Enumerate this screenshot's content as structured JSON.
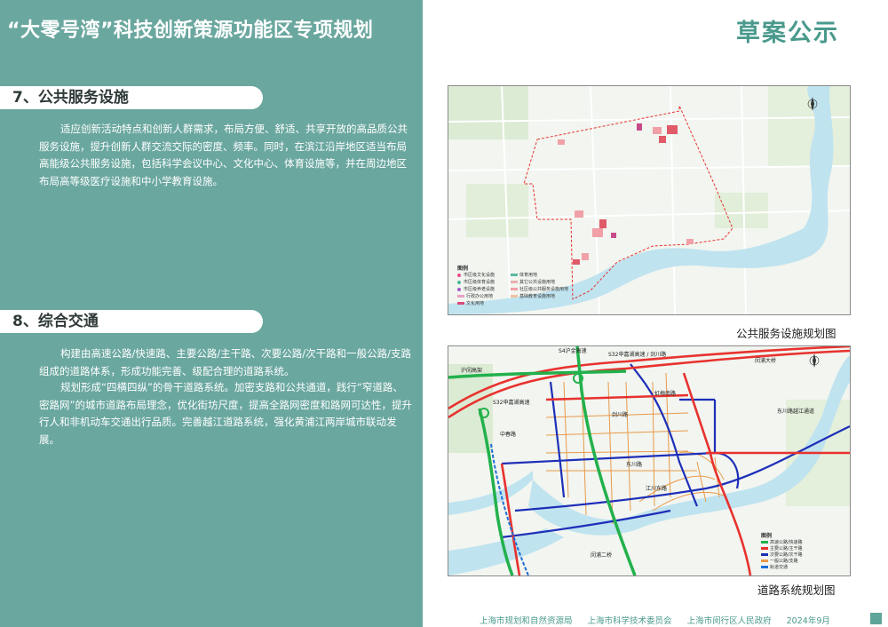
{
  "header": {
    "title": "“大零号湾”科技创新策源功能区专项规划",
    "status": "草案公示"
  },
  "sections": [
    {
      "heading": "7、公共服务设施",
      "paragraphs": [
        "适应创新活动特点和创新人群需求，布局方便、舒适、共享开放的高品质公共服务设施，提升创新人群交流交际的密度、频率。同时，在滨江沿岸地区适当布局高能级公共服务设施，包括科学会议中心、文化中心、体育设施等，并在周边地区布局高等级医疗设施和中小学教育设施。"
      ]
    },
    {
      "heading": "8、综合交通",
      "paragraphs": [
        "构建由高速公路/快速路、主要公路/主干路、次要公路/次干路和一般公路/支路组成的道路体系，形成功能完善、级配合理的道路系统。",
        "规划形成“四横四纵”的骨干道路系统。加密支路和公共通道，践行“窄道路、密路网”的城市道路布局理念，优化街坊尺度，提高全路网密度和路网可达性，提升行人和非机动车交通出行品质。完善越江道路系统，强化黄浦江两岸城市联动发展。"
      ]
    }
  ],
  "map1": {
    "caption": "公共服务设施规划图",
    "legend_title": "图例",
    "legend_items": [
      "市区级文化设施",
      "市区级体育设施",
      "市区级养老设施",
      "行政办公用地",
      "文化用地",
      "体育用地",
      "其它公共设施用地",
      "社区级公共服务设施用地",
      "基础教育设施用地"
    ]
  },
  "map2": {
    "caption": "道路系统规划图",
    "road_labels": [
      "S32申嘉湖高速 / 剑川路",
      "S4沪金高速",
      "沪闵高架",
      "中春路",
      "东川路",
      "虹梅南路",
      "江川东路",
      "闵浦二桥",
      "剑川路",
      "S32申嘉湖高速",
      "闵浦大桥",
      "东川路越江通道"
    ],
    "legend_title": "图例",
    "legend_items": [
      "高速公路/快速路",
      "主要公路/主干路",
      "次要公路/次干路",
      "一般公路/支路",
      "轨道交通"
    ]
  },
  "footer": {
    "org1": "上海市规划和自然资源局",
    "org2": "上海市科学技术委员会",
    "org3": "上海市闵行区人民政府",
    "date": "2024年9月"
  },
  "colors": {
    "panel": "#6aa79f",
    "accent": "#4a9a8c",
    "river": "#bfe3ef",
    "expressway_red": "#e8322e",
    "expressway_green": "#22b14c",
    "arterial_blue": "#1d2fb8",
    "local_orange": "#e89a4a"
  }
}
